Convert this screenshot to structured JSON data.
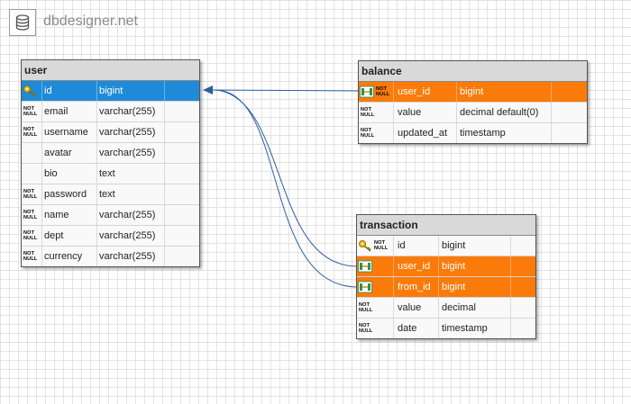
{
  "app": {
    "brand": "dbdesigner.net"
  },
  "tables": {
    "user": {
      "title": "user",
      "rows": [
        {
          "name": "id",
          "type": "bigint",
          "icon": "primary-key-icon"
        },
        {
          "name": "email",
          "type": "varchar(255)",
          "badge": "NOT NULL"
        },
        {
          "name": "username",
          "type": "varchar(255)",
          "badge": "NOT NULL"
        },
        {
          "name": "avatar",
          "type": "varchar(255)"
        },
        {
          "name": "bio",
          "type": "text"
        },
        {
          "name": "password",
          "type": "text",
          "badge": "NOT NULL"
        },
        {
          "name": "name",
          "type": "varchar(255)",
          "badge": "NOT NULL"
        },
        {
          "name": "dept",
          "type": "varchar(255)",
          "badge": "NOT NULL"
        },
        {
          "name": "currency",
          "type": "varchar(255)",
          "badge": "NOT NULL"
        }
      ]
    },
    "balance": {
      "title": "balance",
      "rows": [
        {
          "name": "user_id",
          "type": "bigint",
          "icon": "foreign-key-icon",
          "badge": "NOT NULL"
        },
        {
          "name": "value",
          "type": "decimal default(0)",
          "badge": "NOT NULL"
        },
        {
          "name": "updated_at",
          "type": "timestamp",
          "badge": "NOT NULL"
        }
      ]
    },
    "transaction": {
      "title": "transaction",
      "rows": [
        {
          "name": "id",
          "type": "bigint",
          "icon": "primary-key-icon",
          "badge": "NOT NULL"
        },
        {
          "name": "user_id",
          "type": "bigint",
          "icon": "foreign-key-icon"
        },
        {
          "name": "from_id",
          "type": "bigint",
          "icon": "foreign-key-icon"
        },
        {
          "name": "value",
          "type": "decimal",
          "badge": "NOT NULL"
        },
        {
          "name": "date",
          "type": "timestamp",
          "badge": "NOT NULL"
        }
      ]
    }
  },
  "colors": {
    "selected": "#1f8ad8",
    "foreign_key": "#fa7a0a",
    "relation_line": "#2e5f9e"
  }
}
